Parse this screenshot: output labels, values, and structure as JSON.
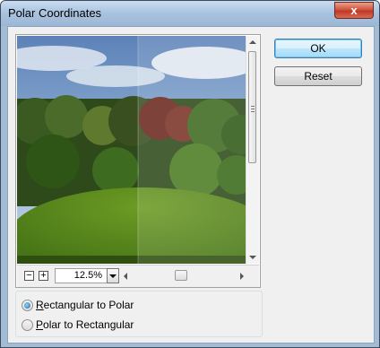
{
  "window": {
    "title": "Polar Coordinates",
    "close_symbol": "x"
  },
  "preview": {
    "zoom_out_symbol": "−",
    "zoom_in_symbol": "+",
    "zoom_value": "12.5%"
  },
  "buttons": {
    "ok_label": "OK",
    "reset_label": "Reset"
  },
  "options": {
    "selected": "rect_to_polar",
    "rect_to_polar": {
      "accel": "R",
      "rest": "ectangular to Polar"
    },
    "polar_to_rect": {
      "accel": "P",
      "rest": "olar to Rectangular"
    }
  },
  "colors": {
    "titlebar": "#a8c2de",
    "close_button": "#c0392b",
    "dialog_bg": "#f0f0f0",
    "ok_border": "#3c7fb1"
  }
}
